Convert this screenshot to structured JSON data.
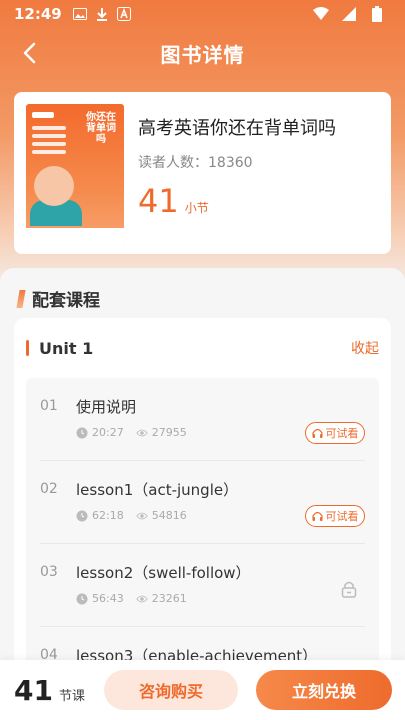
{
  "status_bar": {
    "time": "12:49"
  },
  "nav": {
    "title": "图书详情"
  },
  "book": {
    "title": "高考英语你还在背单词吗",
    "readers": "读者人数：18360",
    "lesson_count": "41",
    "lesson_unit": "小节",
    "cover_text": "你还在背单词吗"
  },
  "section": {
    "title": "配套课程"
  },
  "unit": {
    "title": "Unit 1",
    "collapse_label": "收起"
  },
  "lessons": [
    {
      "no": "01",
      "name": "使用说明",
      "duration": "20:27",
      "views": "27955",
      "trial": "可试看",
      "locked": false
    },
    {
      "no": "02",
      "name": "lesson1（act-jungle）",
      "duration": "62:18",
      "views": "54816",
      "trial": "可试看",
      "locked": false
    },
    {
      "no": "03",
      "name": "lesson2（swell-follow）",
      "duration": "56:43",
      "views": "23261",
      "trial": "",
      "locked": true
    },
    {
      "no": "04",
      "name": "lesson3（enable-achievement）",
      "duration": "",
      "views": "",
      "trial": "",
      "locked": false
    }
  ],
  "bottom": {
    "total_num": "41",
    "total_unit": "节课",
    "consult_label": "咨询购买",
    "redeem_label": "立刻兑换"
  },
  "colors": {
    "accent": "#ee6b2c",
    "accent_light": "#fde7dd"
  }
}
